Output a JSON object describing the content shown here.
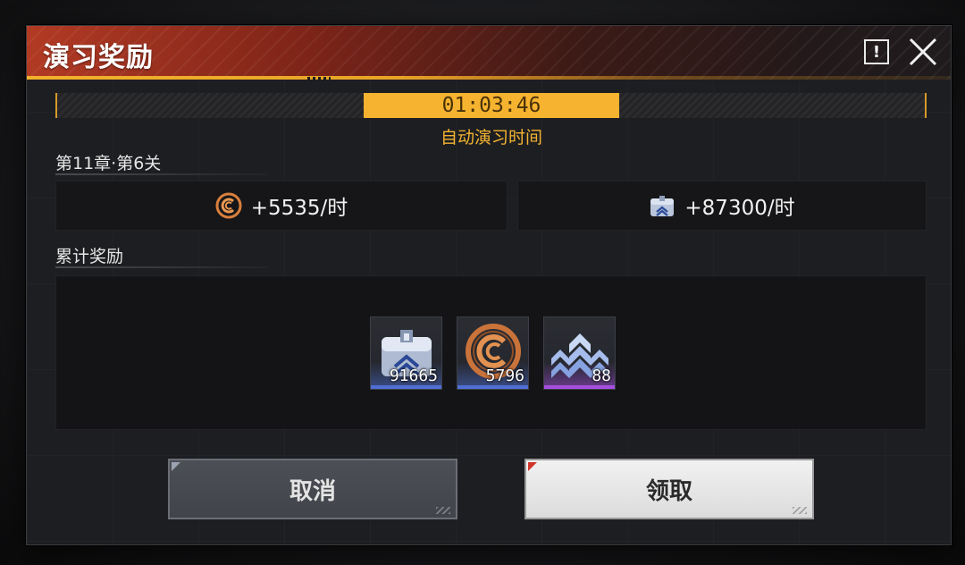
{
  "dialog": {
    "title": "演习奖励",
    "info_icon": "exclamation-icon",
    "close_icon": "close-icon"
  },
  "timer": {
    "value": "01:03:46",
    "label": "自动演习时间"
  },
  "stage": {
    "label": "第11章·第6关",
    "rates": [
      {
        "icon": "coin-icon",
        "text": "+5535/时"
      },
      {
        "icon": "supply-chest-icon",
        "text": "+87300/时"
      }
    ]
  },
  "accumulated": {
    "label": "累计奖励",
    "items": [
      {
        "icon": "supply-chest-icon",
        "count": "91665",
        "rarity_color": "#4f6fd6"
      },
      {
        "icon": "coin-icon",
        "count": "5796",
        "rarity_color": "#4f6fd6"
      },
      {
        "icon": "rank-chevrons-icon",
        "count": "88",
        "rarity_color": "#a64fe0"
      }
    ]
  },
  "buttons": {
    "cancel": "取消",
    "confirm": "领取"
  },
  "colors": {
    "accent": "#f5b32f",
    "header_red": "#b23a24"
  }
}
